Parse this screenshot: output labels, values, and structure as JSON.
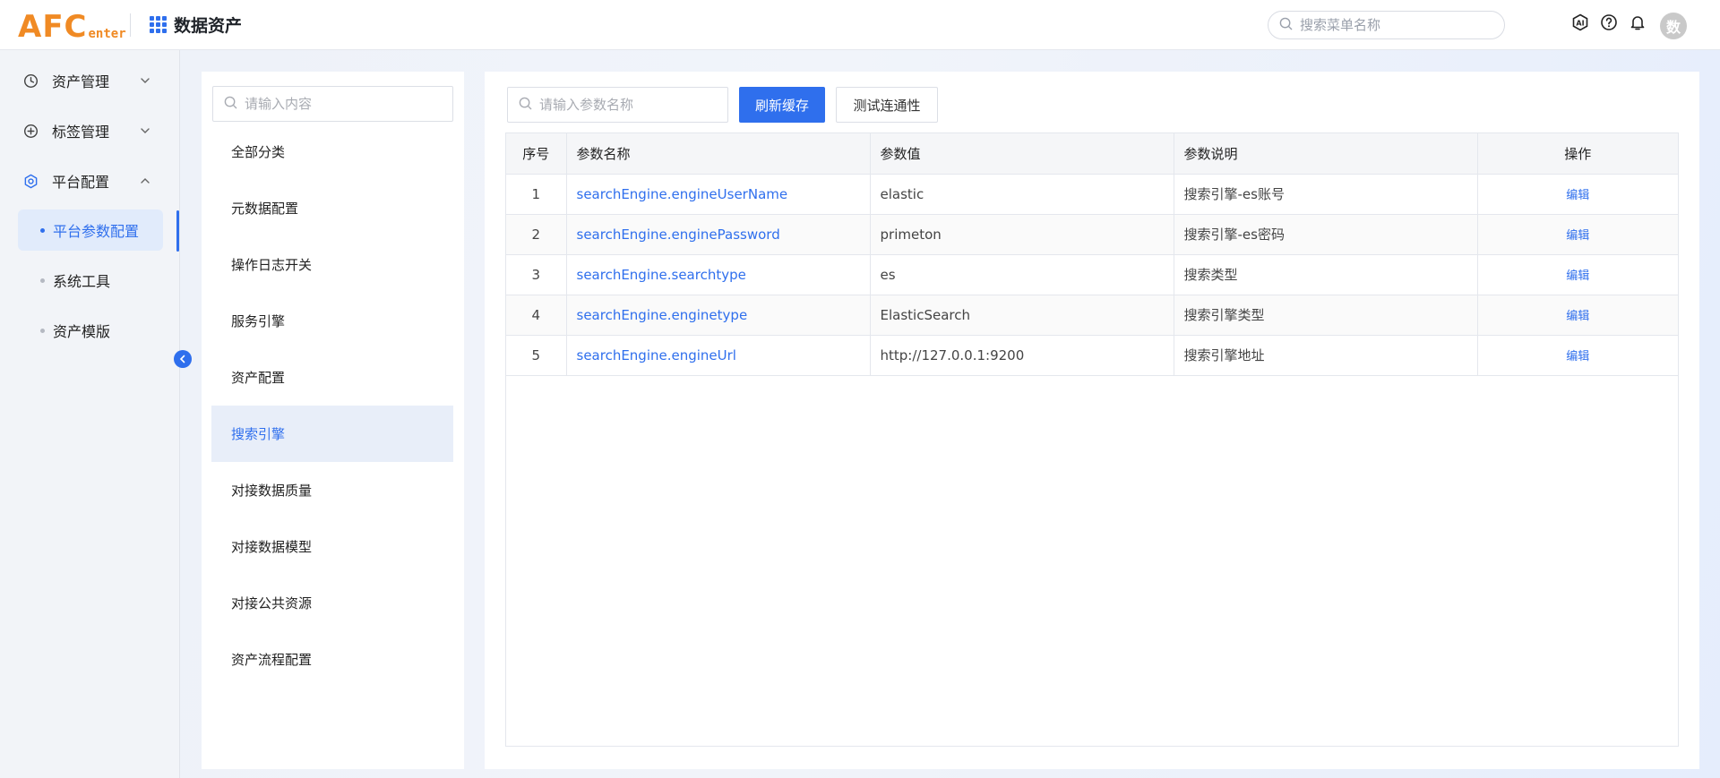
{
  "header": {
    "logo_big": "AFC",
    "logo_small": "enter",
    "app_title": "数据资产",
    "menu_search_placeholder": "搜索菜单名称",
    "avatar_text": "数",
    "icons": [
      "ai-icon",
      "help-icon",
      "bell-icon"
    ]
  },
  "sidebar": {
    "items": [
      {
        "label": "资产管理",
        "icon": "clock-icon",
        "expanded": false
      },
      {
        "label": "标签管理",
        "icon": "plus-circle-icon",
        "expanded": false
      },
      {
        "label": "平台配置",
        "icon": "settings-icon",
        "expanded": true
      }
    ],
    "sub_items": [
      {
        "label": "平台参数配置",
        "active": true
      },
      {
        "label": "系统工具",
        "active": false
      },
      {
        "label": "资产模版",
        "active": false
      }
    ]
  },
  "categories": {
    "search_placeholder": "请输入内容",
    "items": [
      {
        "label": "全部分类"
      },
      {
        "label": "元数据配置"
      },
      {
        "label": "操作日志开关"
      },
      {
        "label": "服务引擎"
      },
      {
        "label": "资产配置"
      },
      {
        "label": "搜索引擎",
        "active": true
      },
      {
        "label": "对接数据质量"
      },
      {
        "label": "对接数据模型"
      },
      {
        "label": "对接公共资源"
      },
      {
        "label": "资产流程配置"
      }
    ]
  },
  "main": {
    "search_placeholder": "请输入参数名称",
    "refresh_button": "刷新缓存",
    "test_button": "测试连通性",
    "columns": [
      "序号",
      "参数名称",
      "参数值",
      "参数说明",
      "操作"
    ],
    "rows": [
      {
        "idx": "1",
        "name": "searchEngine.engineUserName",
        "value": "elastic",
        "desc": "搜索引擎-es账号",
        "op": "编辑"
      },
      {
        "idx": "2",
        "name": "searchEngine.enginePassword",
        "value": "primeton",
        "desc": "搜索引擎-es密码",
        "op": "编辑"
      },
      {
        "idx": "3",
        "name": "searchEngine.searchtype",
        "value": "es",
        "desc": "搜索类型",
        "op": "编辑"
      },
      {
        "idx": "4",
        "name": "searchEngine.enginetype",
        "value": "ElasticSearch",
        "desc": "搜索引擎类型",
        "op": "编辑"
      },
      {
        "idx": "5",
        "name": "searchEngine.engineUrl",
        "value": "http://127.0.0.1:9200",
        "desc": "搜索引擎地址",
        "op": "编辑"
      }
    ]
  },
  "colors": {
    "primary": "#2f6fed",
    "logo": "#f08a24"
  }
}
